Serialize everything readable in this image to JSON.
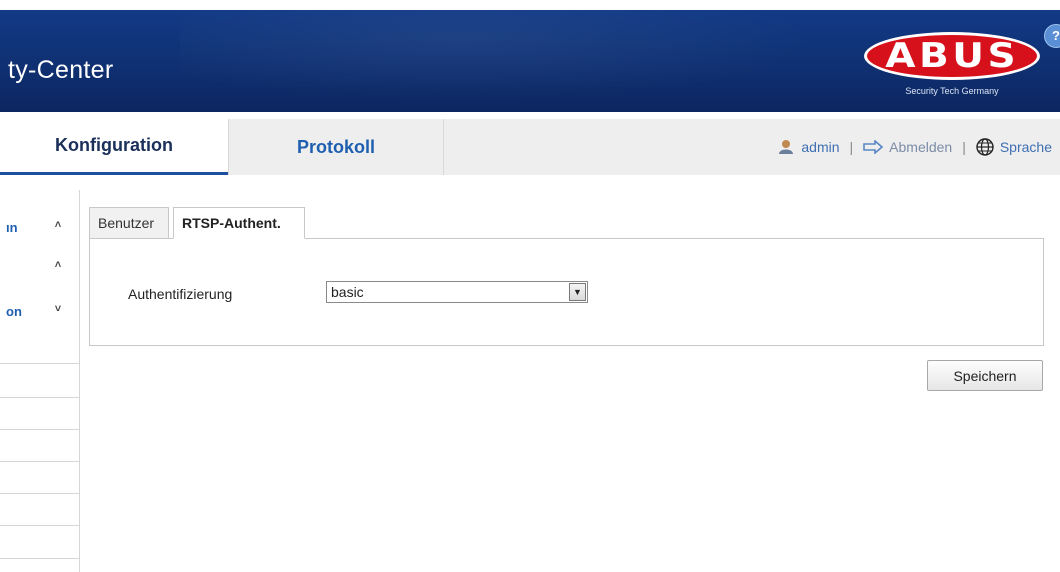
{
  "header": {
    "title": "ty-Center",
    "logo": {
      "word": "ABUS",
      "tagline": "Security Tech Germany"
    },
    "help_icon": "?"
  },
  "nav": {
    "tabs": [
      {
        "label": "Konfiguration",
        "active": true
      },
      {
        "label": "Protokoll",
        "active": false
      }
    ],
    "user": {
      "icon": "user-icon",
      "label": "admin"
    },
    "separator": "|",
    "logout": {
      "icon": "logout-icon",
      "label": "Abmelden"
    },
    "language": {
      "icon": "globe-icon",
      "label": "Sprache"
    }
  },
  "sidebar": {
    "items": [
      {
        "label": "ın",
        "chevron": "˄"
      },
      {
        "label": "",
        "chevron": "˄"
      },
      {
        "label": "on",
        "chevron": "˅"
      }
    ]
  },
  "content": {
    "tabs": [
      {
        "label": "Benutzer",
        "active": false
      },
      {
        "label": "RTSP-Authent.",
        "active": true
      }
    ],
    "field": {
      "label": "Authentifizierung",
      "value": "basic"
    },
    "save_label": "Speichern"
  },
  "colors": {
    "header_bg": "#123a86",
    "logo_red": "#d6111b",
    "link_blue": "#1f5fb0",
    "active_tab_text": "#1a2f5a"
  }
}
